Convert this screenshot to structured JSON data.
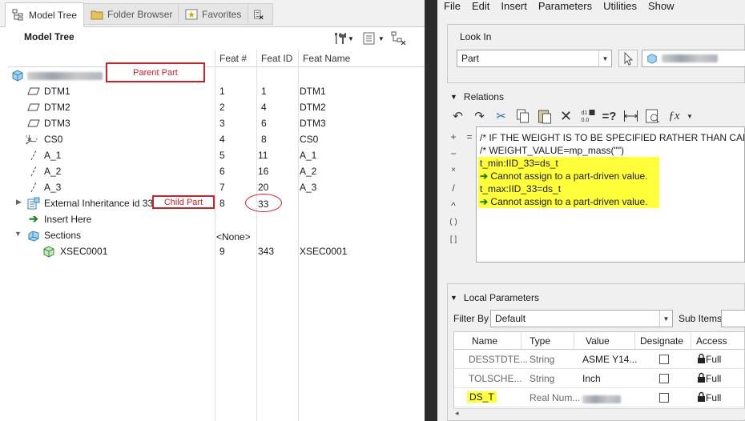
{
  "left_panel": {
    "tabs": [
      {
        "label": "Model Tree",
        "active": true
      },
      {
        "label": "Folder Browser",
        "active": false
      },
      {
        "label": "Favorites",
        "active": false
      }
    ],
    "title": "Model Tree",
    "columns": {
      "feat_num": "Feat #",
      "feat_id": "Feat ID",
      "feat_name": "Feat Name"
    },
    "annotations": {
      "parent_part": "Parent Part",
      "child_part": "Child Part"
    },
    "rows": [
      {
        "name": "DTM1",
        "num": "1",
        "id": "1",
        "feat": "DTM1"
      },
      {
        "name": "DTM2",
        "num": "2",
        "id": "4",
        "feat": "DTM2"
      },
      {
        "name": "DTM3",
        "num": "3",
        "id": "6",
        "feat": "DTM3"
      },
      {
        "name": "CS0",
        "num": "4",
        "id": "8",
        "feat": "CS0"
      },
      {
        "name": "A_1",
        "num": "5",
        "id": "11",
        "feat": "A_1"
      },
      {
        "name": "A_2",
        "num": "6",
        "id": "16",
        "feat": "A_2"
      },
      {
        "name": "A_3",
        "num": "7",
        "id": "20",
        "feat": "A_3"
      },
      {
        "name": "External Inheritance id 33",
        "num": "8",
        "id": "33",
        "feat": ""
      },
      {
        "name": "Insert Here",
        "num": "",
        "id": "",
        "feat": ""
      },
      {
        "name": "Sections",
        "num": "<None>",
        "id": "",
        "feat": ""
      },
      {
        "name": "XSEC0001",
        "num": "9",
        "id": "343",
        "feat": "XSEC0001"
      }
    ]
  },
  "right_panel": {
    "menu": [
      "File",
      "Edit",
      "Insert",
      "Parameters",
      "Utilities",
      "Show"
    ],
    "look_in": {
      "label": "Look In",
      "value": "Part"
    },
    "relations": {
      "label": "Relations",
      "operators": [
        "+",
        "−",
        "×",
        "/",
        "^",
        "( )",
        "[ ]"
      ],
      "equals": "=",
      "lines": [
        {
          "text": "/* IF THE WEIGHT IS TO BE SPECIFIED RATHER THAN CALCULATED",
          "highlight": false,
          "arrow": false
        },
        {
          "text": "/* WEIGHT_VALUE=mp_mass(\"\")",
          "highlight": false,
          "arrow": false
        },
        {
          "text": "t_min:IID_33=ds_t",
          "highlight": true,
          "arrow": false
        },
        {
          "text": "Cannot assign to a part-driven value.",
          "highlight": true,
          "arrow": true
        },
        {
          "text": "t_max:IID_33=ds_t",
          "highlight": true,
          "arrow": false
        },
        {
          "text": "Cannot assign to a part-driven value.",
          "highlight": true,
          "arrow": true
        }
      ]
    },
    "local_parameters": {
      "label": "Local Parameters",
      "filter_label": "Filter By",
      "filter_value": "Default",
      "sub_items_label": "Sub Items",
      "columns": [
        "Name",
        "Type",
        "Value",
        "Designate",
        "Access"
      ],
      "rows": [
        {
          "name": "DESSTDTE...",
          "type": "String",
          "value": "ASME Y14...",
          "access": "Full",
          "name_highlight": false
        },
        {
          "name": "TOLSCHE...",
          "type": "String",
          "value": "Inch",
          "access": "Full",
          "name_highlight": false
        },
        {
          "name": "DS_T",
          "type": "Real Num...",
          "value": "",
          "access": "Full",
          "name_highlight": true
        }
      ]
    }
  },
  "colors": {
    "annotation_red": "#d0202a",
    "highlight_yellow": "#ffff3a",
    "divider": "#2b2b2b"
  }
}
